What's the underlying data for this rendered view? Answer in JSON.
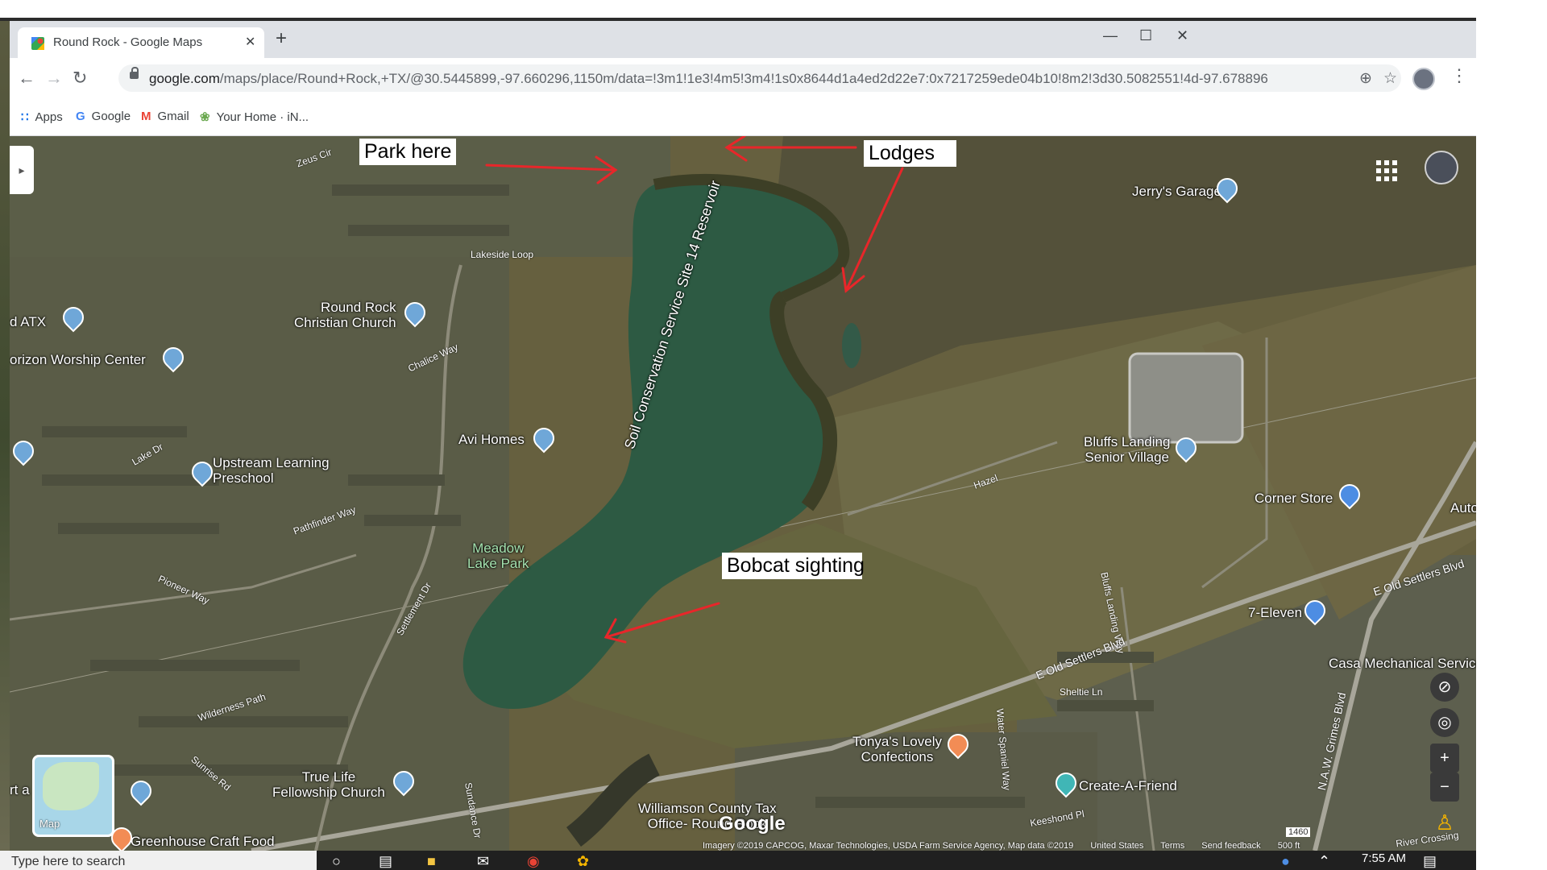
{
  "browser": {
    "tab_title": "Round Rock - Google Maps",
    "tab_close": "✕",
    "new_tab": "+",
    "url_domain": "google.com",
    "url_rest": "/maps/place/Round+Rock,+TX/@30.5445899,-97.660296,1150m/data=!3m1!1e3!4m5!3m4!1s0x8644d1a4ed2d22e7:0x7217259ede04b10!8m2!3d30.5082551!4d-97.678896",
    "bookmarks": [
      {
        "icon": "apps-grid-icon",
        "label": "Apps"
      },
      {
        "icon": "google-g-icon",
        "label": "Google"
      },
      {
        "icon": "gmail-icon",
        "label": "Gmail"
      },
      {
        "icon": "plant-icon",
        "label": "Your Home · iN..."
      }
    ]
  },
  "annotations": {
    "park_here": "Park here",
    "lodges": "Lodges",
    "bobcat": "Bobcat sighting"
  },
  "places": {
    "jerrys_garage": "Jerry's Garage",
    "round_rock_christian": "Round Rock\nChristian Church",
    "horizon_worship": "orizon Worship Center",
    "d_atx": "d ATX",
    "avi_homes": "Avi Homes",
    "upstream": "Upstream Learning\nPreschool",
    "meadow_lake": "Meadow\nLake Park",
    "bluffs_landing": "Bluffs Landing\nSenior Village",
    "corner_store": "Corner Store",
    "auto": "Auto",
    "seven_eleven": "7-Eleven",
    "casa_mechanical": "Casa Mechanical Service",
    "tonyas": "Tonya's Lovely\nConfections",
    "create_a_friend": "Create-A-Friend",
    "true_life": "True Life\nFellowship Church",
    "williamson": "Williamson County Tax\nOffice- Round Rock",
    "greenhouse": "Greenhouse Craft Food",
    "rt_a": "rt a",
    "reservoir": "Soil Conservation Service Site 14 Reservoir"
  },
  "streets": {
    "zeus": "Zeus Cir",
    "lakeside": "Lakeside Loop",
    "chalice": "Chalice Way",
    "lake_dr": "Lake Dr",
    "pathfinder": "Pathfinder Way",
    "pioneer": "Pioneer Way",
    "settlement": "Settlement Dr",
    "wilderness": "Wilderness Path",
    "sunrise": "Sunrise Rd",
    "sundance": "Sundance Dr",
    "hazel": "Hazel",
    "bluffs_landing_way": "Bluffs Landing Way",
    "e_old_settlers_1": "E Old Settlers Blvd",
    "e_old_settlers_2": "E Old Settlers Blvd",
    "water_spaniel": "Water Spaniel Way",
    "sheltie": "Sheltie Ln",
    "keeshond": "Keeshond Pl",
    "grimes": "N.A.W. Grimes Blvd",
    "river_crossing": "River Crossing",
    "route_1460": "1460"
  },
  "map_ui": {
    "minimap_label": "Map",
    "google_logo": "Google",
    "imagery_credit": "Imagery ©2019 CAPCOG, Maxar Technologies, USDA Farm Service Agency, Map data ©2019",
    "united_states": "United States",
    "terms": "Terms",
    "send_feedback": "Send feedback",
    "scale": "500 ft",
    "zoom_in": "+",
    "zoom_out": "−"
  },
  "taskbar": {
    "search_placeholder": "Type here to search",
    "time": "7:55 AM"
  },
  "colors": {
    "annotation_arrow": "#e8262a",
    "water": "#2e5a44",
    "terrain": "#6b6444"
  }
}
